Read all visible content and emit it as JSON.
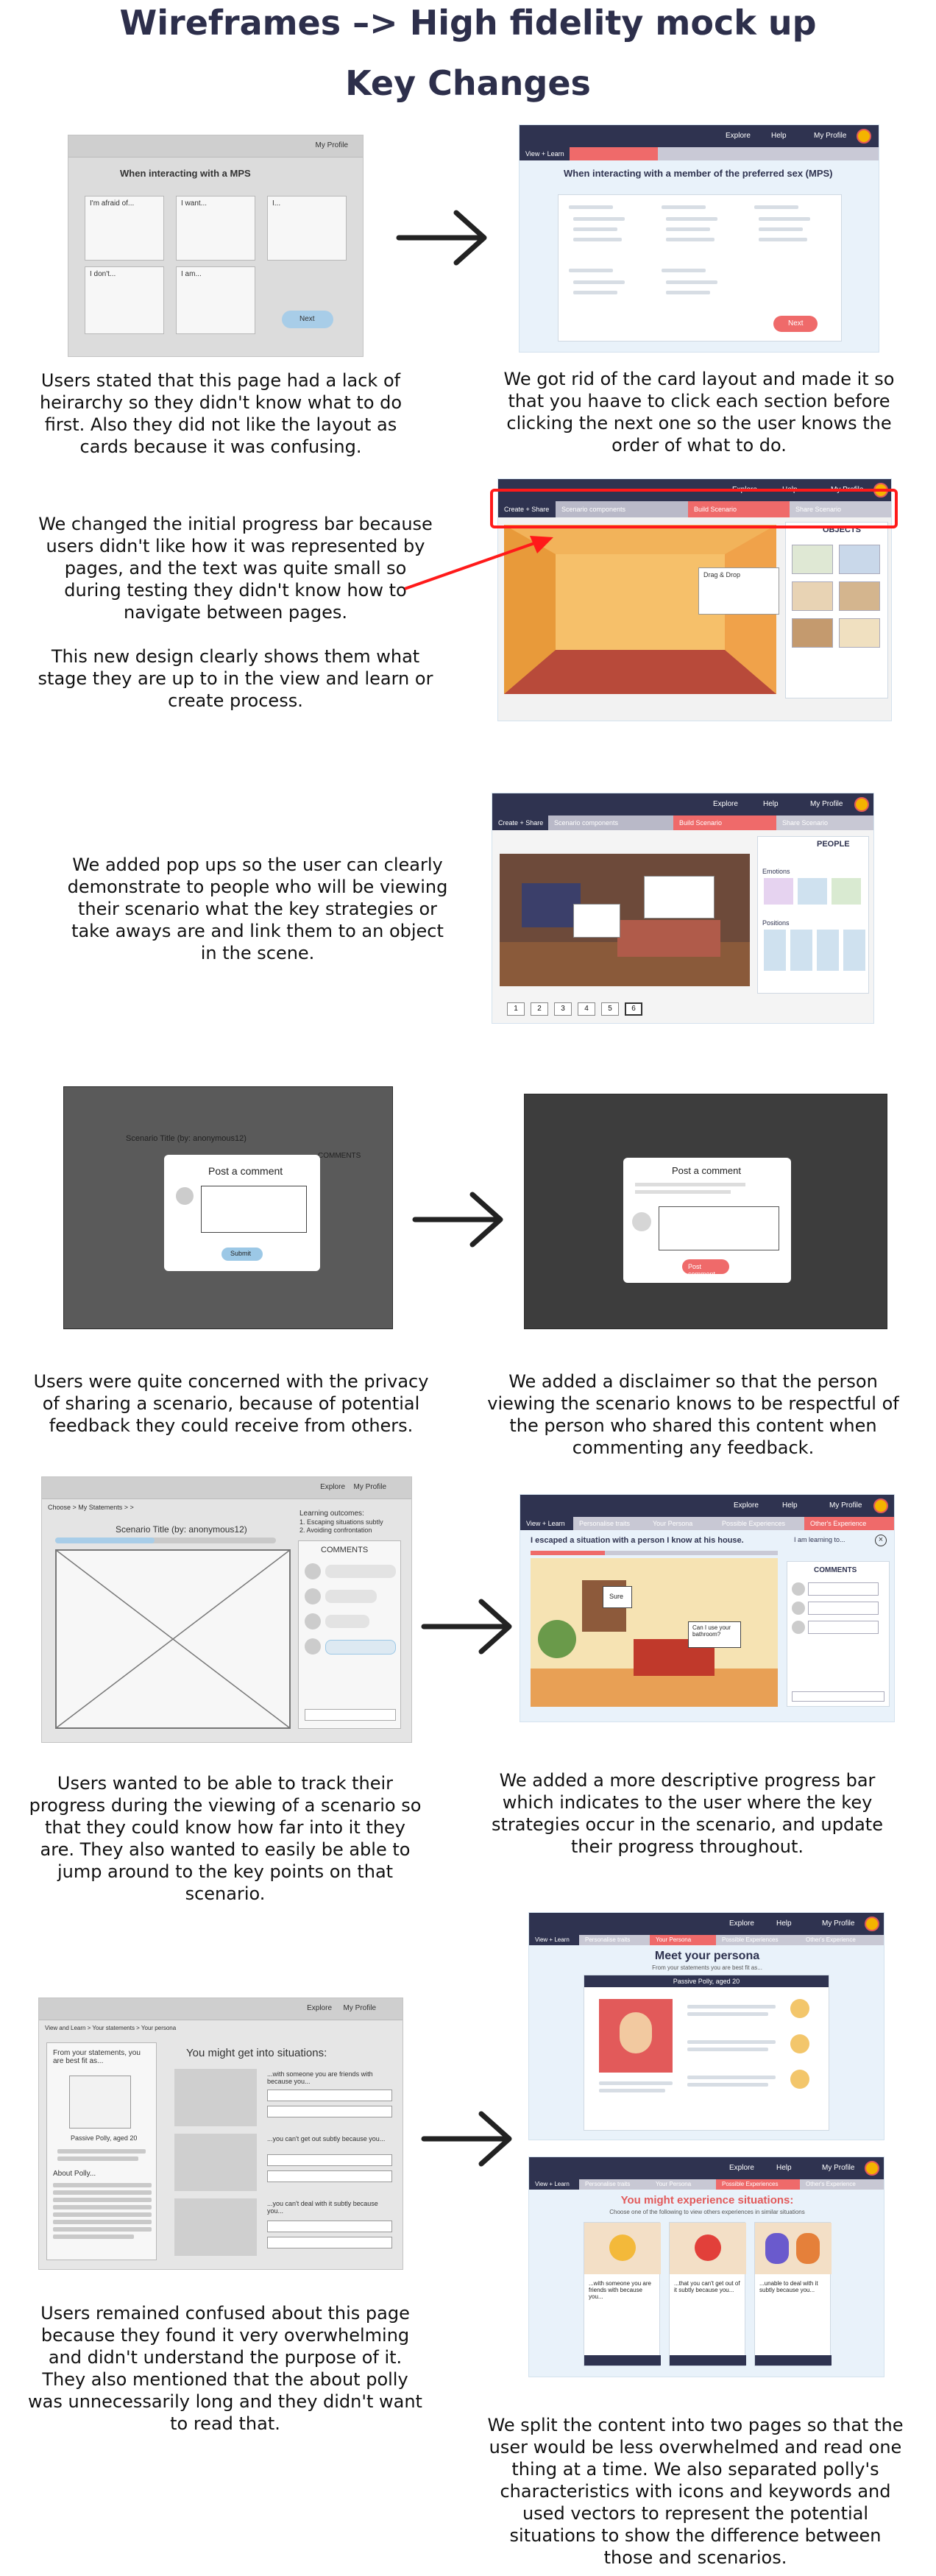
{
  "header": {
    "title": "Wireframes –> High fidelity mock up",
    "subtitle": "Key Changes"
  },
  "section1": {
    "wire": {
      "heading": "When interacting with a MPS",
      "nav_profile": "My Profile",
      "col1": "I'm afraid of...",
      "col2": "I want...",
      "col3": "I...",
      "col4": "I don't...",
      "col5": "I am...",
      "button": "Next"
    },
    "hifi": {
      "heading": "When interacting with a member of the preferred sex (MPS)",
      "nav_explore": "Explore",
      "nav_help": "Help",
      "nav_profile": "My Profile",
      "prog1": "View + Learn",
      "button": "Next"
    },
    "caption_left": "Users stated that this page had a lack of heirarchy so they didn't know what to do first. Also they did not like the layout as cards because it was confusing.",
    "caption_right": "We got rid of the card layout and made it so that you haave to click each section before clicking the next one so the user knows the order of what to do."
  },
  "section2": {
    "caption": "We changed the initial progress bar because users didn't like how it was represented by pages, and the text was quite small so during testing they didn't know how to navigate between pages.\n\nThis new design clearly shows them what stage they are up to in the view and learn or create process.",
    "hifi": {
      "prog1": "Create + Share",
      "prog2": "Scenario components",
      "prog3": "Build Scenario",
      "prog4": "Share Scenario",
      "nav_explore": "Explore",
      "nav_help": "Help",
      "nav_profile": "My Profile",
      "side_title": "OBJECTS",
      "popup": "Drag & Drop"
    }
  },
  "section3": {
    "caption": "We added pop ups so the user can clearly demonstrate to people who will be viewing their scenario what the key strategies or take aways are and link them to an object in the scene.",
    "hifi": {
      "prog1": "Create + Share",
      "prog2": "Scenario components",
      "prog3": "Build Scenario",
      "prog4": "Share Scenario",
      "nav_explore": "Explore",
      "nav_help": "Help",
      "nav_profile": "My Profile",
      "side_title": "PEOPLE",
      "side_sub1": "Emotions",
      "side_sub2": "Positions",
      "pages": [
        "1",
        "2",
        "3",
        "4",
        "5",
        "6"
      ]
    }
  },
  "section4": {
    "wire": {
      "modal_title": "Post a comment",
      "submit": "Submit",
      "bg_title": "Scenario Title (by: anonymous12)",
      "comments": "COMMENTS"
    },
    "hifi": {
      "modal_title": "Post a comment",
      "post": "Post comment"
    },
    "caption_left": "Users were quite concerned with the privacy of sharing a scenario, because of potential feedback they could receive from others.",
    "caption_right": "We added a disclaimer so that the person viewing the scenario knows to be respectful of the person who shared this content when commenting any feedback."
  },
  "section5": {
    "wire": {
      "nav_explore": "Explore",
      "nav_profile": "My Profile",
      "breadcrumb": "Choose > My Statements > >",
      "scenario_title": "Scenario Title (by: anonymous12)",
      "learning": "Learning outcomes:",
      "outcome1": "1. Escaping situations subtly",
      "outcome2": "2. Avoiding confrontation",
      "comments": "COMMENTS"
    },
    "hifi": {
      "nav_explore": "Explore",
      "nav_help": "Help",
      "nav_profile": "My Profile",
      "prog1": "View + Learn",
      "prog2": "Personalise traits",
      "prog3": "Your Persona",
      "prog4": "Possible Experiences",
      "prog5": "Other's Experience",
      "scenario_title": "I escaped a situation with a person I know at his house.",
      "learning": "I am learning to...",
      "comments": "COMMENTS",
      "bubble1": "Sure",
      "bubble2": "Can I use your bathroom?"
    },
    "caption_left": "Users wanted to be able to track their progress during the viewing of a scenario so that they could know how far into it they are. They also wanted to easily be able to jump around to the key points on that scenario.",
    "caption_right": "We added a more descriptive progress bar which indicates to the user where the key strategies occur in the scenario, and update their progress throughout."
  },
  "section6": {
    "wire": {
      "nav_explore": "Explore",
      "nav_profile": "My Profile",
      "breadcrumb": "View and Learn > Your statements > Your persona",
      "left_title": "From your statements, you are best fit as...",
      "persona": "Passive Polly, aged 20",
      "about": "About Polly...",
      "right_title": "You might get into situations:",
      "sit1": "...with someone you are friends with because you...",
      "sit2": "...you can't get out subtly because you...",
      "sit3": "...you can't deal with it subtly because you..."
    },
    "hifi_a": {
      "nav_explore": "Explore",
      "nav_help": "Help",
      "nav_profile": "My Profile",
      "prog1": "View + Learn",
      "prog2": "Personalise traits",
      "prog3": "Your Persona",
      "prog4": "Possible Experiences",
      "prog5": "Other's Experience",
      "title": "Meet your persona",
      "subtitle": "From your statements you are best fit as...",
      "persona": "Passive Polly, aged 20"
    },
    "hifi_b": {
      "nav_explore": "Explore",
      "nav_help": "Help",
      "nav_profile": "My Profile",
      "prog1": "View + Learn",
      "prog2": "Personalise traits",
      "prog3": "Your Persona",
      "prog4": "Possible Experiences",
      "prog5": "Other's Experience",
      "title": "You might experience situations:",
      "subtitle": "Choose one of the following to view others experiences in similar situations",
      "card1": "...with someone you are friends with because you...",
      "card2": "...that you can't get out of it subtly because you...",
      "card3": "...unable to deal with it subtly because you..."
    },
    "caption_left": "Users remained confused about this page because they found it very overwhelming and didn't understand the purpose of it. They also mentioned that the about polly was unnecessarily long and they didn't want to read that.",
    "caption_right": "We split the content into two pages so that the user would be less overwhelmed and read one thing at a time. We also separated polly's characteristics with icons and keywords and used vectors to represent the potential situations to show the difference between those and scenarios."
  },
  "colors": {
    "navy": "#2f3350",
    "coral": "#ef6a6a",
    "arrow": "#222222",
    "highlight": "#ff1a1a"
  }
}
